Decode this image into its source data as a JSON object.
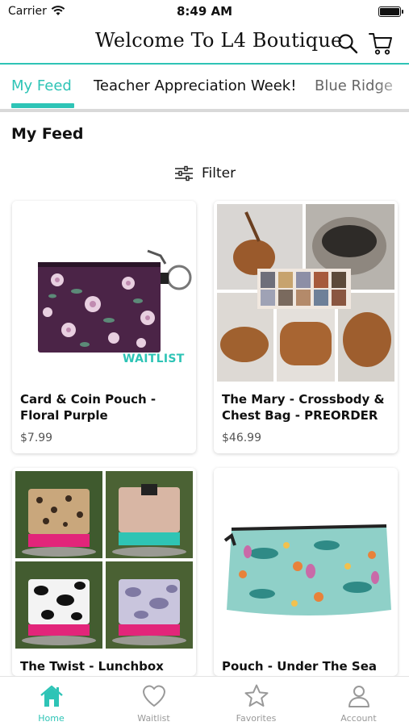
{
  "status_bar": {
    "carrier": "Carrier",
    "time": "8:49 AM"
  },
  "header": {
    "title": "Welcome To L4 Boutique",
    "search_icon": "search-icon",
    "cart_icon": "cart-icon"
  },
  "tabs": [
    {
      "label": "My Feed",
      "active": true
    },
    {
      "label": "Teacher Appreciation Week!",
      "active": false
    },
    {
      "label": "Blue Ridge",
      "active": false
    }
  ],
  "feed": {
    "title": "My Feed",
    "filter_label": "Filter"
  },
  "products": [
    {
      "name": "Card & Coin Pouch - Floral Purple",
      "price": "$7.99",
      "tag": "WAITLIST"
    },
    {
      "name": "The Mary - Crossbody & Chest Bag - PREORDER",
      "price": "$46.99"
    },
    {
      "name": "The Twist - Lunchbox"
    },
    {
      "name": "Pouch - Under The Sea"
    }
  ],
  "bottom_nav": [
    {
      "label": "Home",
      "icon": "home-icon",
      "active": true
    },
    {
      "label": "Waitlist",
      "icon": "heart-icon",
      "active": false
    },
    {
      "label": "Favorites",
      "icon": "star-icon",
      "active": false
    },
    {
      "label": "Account",
      "icon": "account-icon",
      "active": false
    }
  ],
  "colors": {
    "accent": "#2ec4b6",
    "muted": "#999999"
  }
}
